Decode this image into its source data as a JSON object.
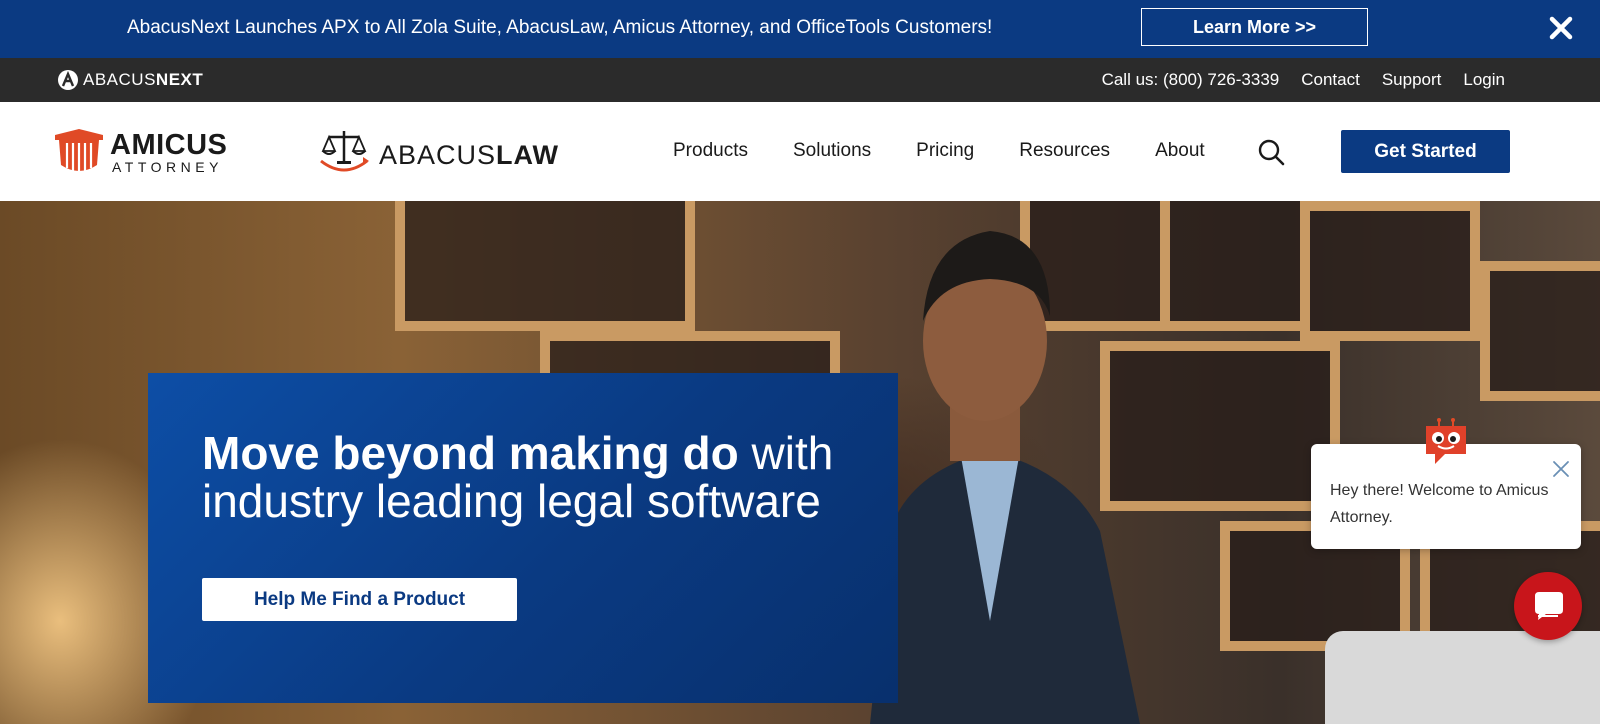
{
  "announcement": {
    "text": "AbacusNext Launches APX to All Zola Suite, AbacusLaw, Amicus Attorney, and OfficeTools Customers!",
    "button_label": "Learn More >>",
    "close_icon": "close-icon"
  },
  "utility_bar": {
    "logo_text_light": "ABACUS",
    "logo_text_bold": "NEXT",
    "links": [
      "Call us: (800) 726-3339",
      "Contact",
      "Support",
      "Login"
    ]
  },
  "nav": {
    "amicus_logo": {
      "line1": "AMICUS",
      "line2": "ATTORNEY"
    },
    "abacuslaw_logo": {
      "light": "ABACUS",
      "bold": "LAW"
    },
    "items": [
      "Products",
      "Solutions",
      "Pricing",
      "Resources",
      "About"
    ],
    "search_icon": "search-icon",
    "cta_label": "Get Started"
  },
  "hero": {
    "title_bold": "Move beyond making do",
    "title_rest": " with industry leading legal software",
    "button_label": "Help Me Find a Product"
  },
  "chat": {
    "message": "Hey there! Welcome to Amicus Attorney.",
    "close_icon": "close-icon",
    "launcher_icon": "chat-bubble-icon"
  },
  "colors": {
    "brand_blue": "#0b3a82",
    "utility_dark": "#2b2b2b",
    "chat_red": "#c8151b",
    "amicus_orange": "#e04a26"
  }
}
